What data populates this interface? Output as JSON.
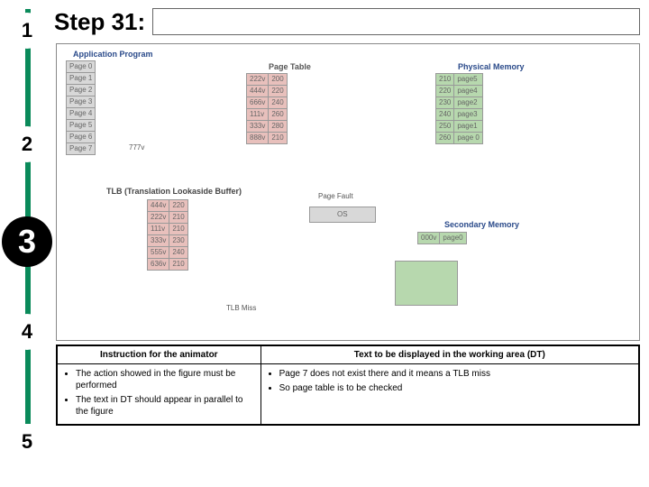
{
  "sidebar": {
    "steps": [
      "1",
      "2",
      "3",
      "4",
      "5"
    ],
    "active_index": 2
  },
  "title": {
    "prefix": "Step 31:",
    "box_value": ""
  },
  "diagram": {
    "app_program": {
      "header": "Application Program",
      "rows": [
        "Page 0",
        "Page 1",
        "Page 2",
        "Page 3",
        "Page 4",
        "Page 5",
        "Page 6",
        "Page 7"
      ],
      "annot": "777v"
    },
    "page_table": {
      "header": "Page Table",
      "rows": [
        [
          "222v",
          "200"
        ],
        [
          "444v",
          "220"
        ],
        [
          "666v",
          "240"
        ],
        [
          "111v",
          "260"
        ],
        [
          "333v",
          "280"
        ],
        [
          "888v",
          "210"
        ]
      ]
    },
    "physical_memory": {
      "header": "Physical Memory",
      "rows": [
        [
          "210",
          "page5"
        ],
        [
          "220",
          "page4"
        ],
        [
          "230",
          "page2"
        ],
        [
          "240",
          "page3"
        ],
        [
          "250",
          "page1"
        ],
        [
          "260",
          "page 0"
        ]
      ]
    },
    "tlb": {
      "header": "TLB (Translation Lookaside Buffer)",
      "rows": [
        [
          "444v",
          "220"
        ],
        [
          "222v",
          "210"
        ],
        [
          "111v",
          "210"
        ],
        [
          "333v",
          "230"
        ],
        [
          "555v",
          "240"
        ],
        [
          "636v",
          "210"
        ]
      ],
      "miss_label": "TLB Miss"
    },
    "page_fault_label": "Page Fault",
    "os_label": "OS",
    "secondary_memory": {
      "header": "Secondary Memory",
      "rows": [
        [
          "000v",
          "page0"
        ]
      ]
    }
  },
  "instructions": {
    "col1_header": "Instruction for the animator",
    "col2_header": "Text to be displayed in the working area (DT)",
    "col1_items": [
      "The action showed in the figure must be performed",
      "The text in DT should appear  in parallel to the figure"
    ],
    "col2_items": [
      "Page 7 does not exist there and it means a TLB miss",
      "So page table is to be checked"
    ]
  }
}
